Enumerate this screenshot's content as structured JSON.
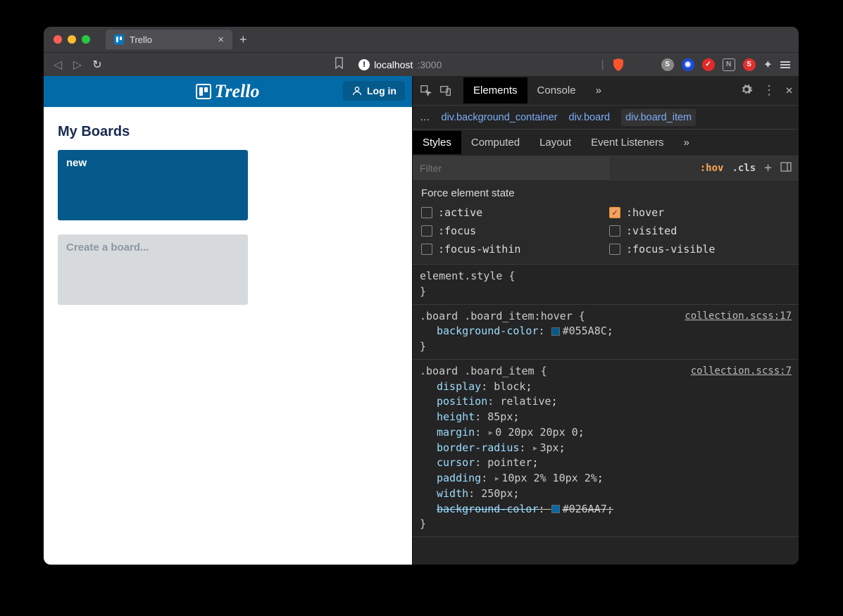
{
  "browser": {
    "tab_title": "Trello",
    "url_host": "localhost",
    "url_port": ":3000"
  },
  "app": {
    "logo_text": "Trello",
    "login_label": "Log in",
    "boards_title": "My Boards",
    "board1_name": "new",
    "create_label": "Create a board..."
  },
  "devtools": {
    "tabs": {
      "elements": "Elements",
      "console": "Console"
    },
    "breadcrumb": {
      "ellipsis": "…",
      "seg1_tag": "div",
      "seg1_cls": ".background_container",
      "seg2_tag": "div",
      "seg2_cls": ".board",
      "seg3_tag": "div",
      "seg3_cls": ".board_item"
    },
    "styles_tabs": {
      "styles": "Styles",
      "computed": "Computed",
      "layout": "Layout",
      "listeners": "Event Listeners"
    },
    "filter_placeholder": "Filter",
    "hov_label": ":hov",
    "cls_label": ".cls",
    "force_title": "Force element state",
    "states": {
      "active": ":active",
      "hover": ":hover",
      "focus": ":focus",
      "visited": ":visited",
      "focus_within": ":focus-within",
      "focus_visible": ":focus-visible"
    },
    "rules": {
      "r0_sel": "element.style {",
      "r0_close": "}",
      "r1_sel": ".board .board_item:hover {",
      "r1_src": "collection.scss:17",
      "r1_p1": "background-color",
      "r1_v1": "#055A8C",
      "r1_close": "}",
      "r2_sel": ".board .board_item {",
      "r2_src": "collection.scss:7",
      "r2_p1": "display",
      "r2_v1": "block",
      "r2_p2": "position",
      "r2_v2": "relative",
      "r2_p3": "height",
      "r2_v3": "85px",
      "r2_p4": "margin",
      "r2_v4": "0 20px 20px 0",
      "r2_p5": "border-radius",
      "r2_v5": "3px",
      "r2_p6": "cursor",
      "r2_v6": "pointer",
      "r2_p7": "padding",
      "r2_v7": "10px 2% 10px 2%",
      "r2_p8": "width",
      "r2_v8": "250px",
      "r2_p9": "background-color",
      "r2_v9": "#026AA7",
      "r2_close": "}"
    }
  }
}
